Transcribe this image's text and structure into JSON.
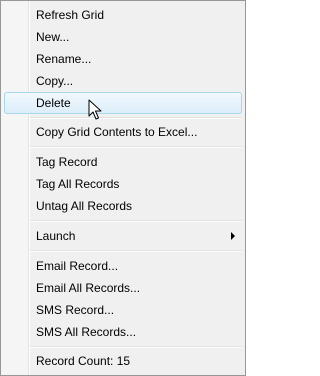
{
  "menu": {
    "refresh_grid": "Refresh Grid",
    "new": "New...",
    "rename": "Rename...",
    "copy": "Copy...",
    "delete": "Delete",
    "copy_grid_contents": "Copy Grid Contents to Excel...",
    "tag_record": "Tag Record",
    "tag_all_records": "Tag All Records",
    "untag_all_records": "Untag All Records",
    "launch": "Launch",
    "email_record": "Email Record...",
    "email_all_records": "Email All Records...",
    "sms_record": "SMS Record...",
    "sms_all_records": "SMS All Records...",
    "record_count": "Record Count: 15"
  },
  "icons": {
    "submenu_arrow": "chevron-right-icon",
    "cursor": "mouse-pointer-icon"
  },
  "colors": {
    "hover_border": "#a8d8eb",
    "hover_fill_top": "#f2f8fd",
    "hover_fill_bottom": "#dceefa",
    "menu_background": "#f0f0f0"
  }
}
